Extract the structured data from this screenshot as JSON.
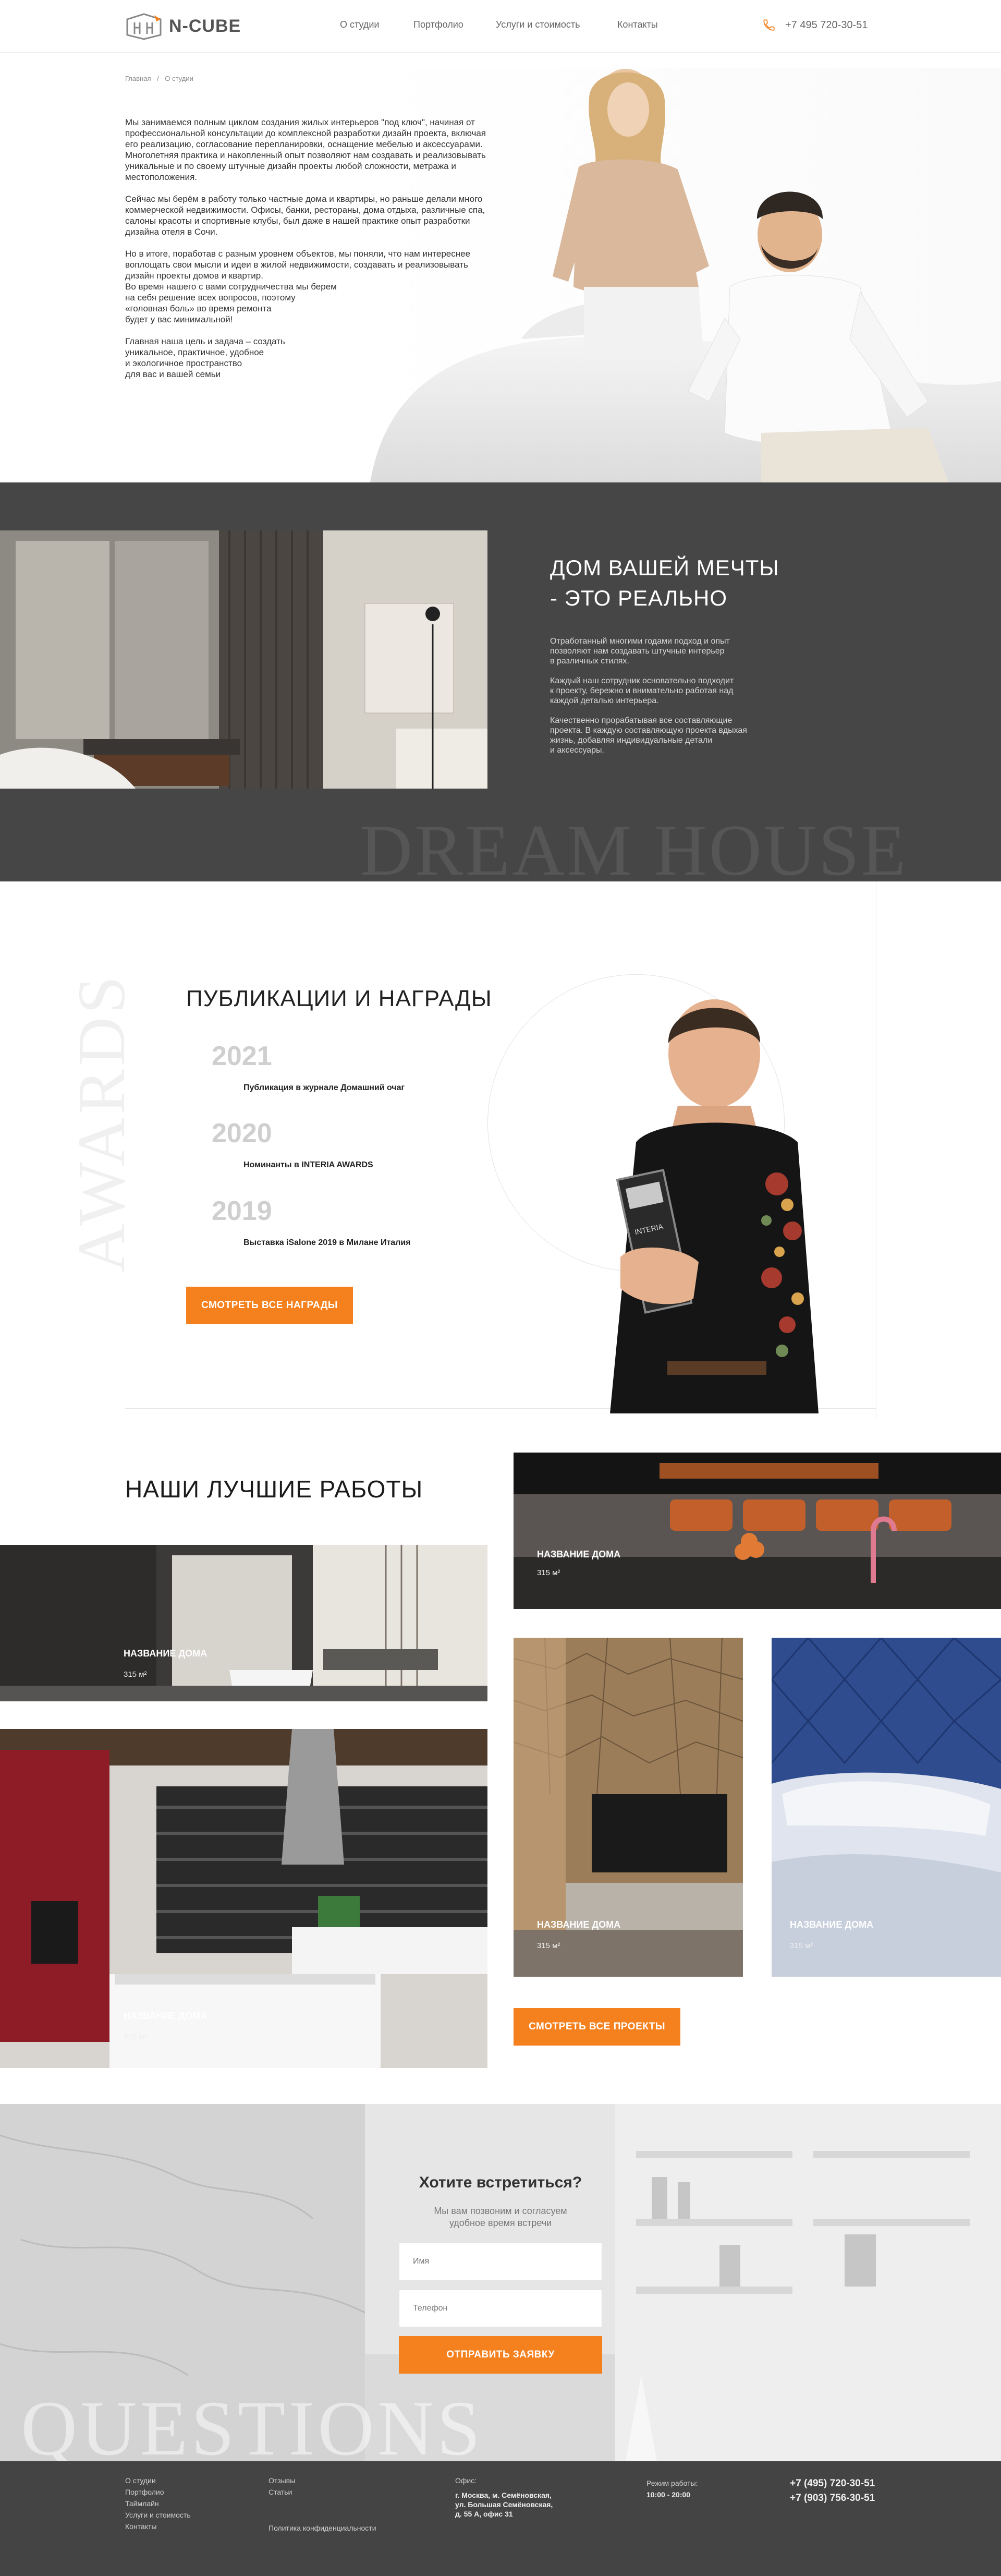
{
  "header": {
    "logo_text": "N-CUBE",
    "nav": [
      "О студии",
      "Портфолио",
      "Услуги и стоимость",
      "Контакты"
    ],
    "phone": "+7 495 720-30-51"
  },
  "about": {
    "breadcrumb_home": "Главная",
    "breadcrumb_sep": "/",
    "breadcrumb_current": "О студии",
    "paragraphs": [
      "Мы занимаемся полным циклом создания жилых интерьеров \"под ключ\", начиная от профессиональной консультации до комплексной разработки дизайн проекта, включая его реализацию, согласование перепланировки, оснащение мебелью и аксессуарами.\nМноголетняя практика и накопленный опыт позволяют нам создавать и реализовывать уникальные и по своему штучные дизайн проекты любой сложности, метража и местоположения.",
      "Сейчас мы берём в работу только частные дома и квартиры, но раньше делали много коммерческой недвижимости. Офисы, банки, рестораны, дома отдыха, различные спа, салоны красоты и спортивные клубы, был даже в нашей практике опыт разработки дизайна отеля в Сочи.",
      "Но в итоге, поработав с разным уровнем объектов, мы поняли, что нам интереснее воплощать свои мысли и идеи в жилой недвижимости, создавать и реализовывать дизайн проекты домов и квартир.\nВо время нашего с вами сотрудничества мы берем\nна себя решение всех вопросов, поэтому\n«головная боль» во время ремонта\nбудет у вас минимальной!",
      "Главная наша цель и задача – создать\nуникальное, практичное, удобное\nи экологичное пространство\nдля вас и вашей семьи"
    ]
  },
  "dream": {
    "title_line1": "ДОМ ВАШЕЙ МЕЧТЫ",
    "title_line2": "- ЭТО РЕАЛЬНО",
    "paragraphs": [
      "Отработанный многими годами подход и опыт\nпозволяют нам создавать штучные интерьер\nв различных стилях.",
      "Каждый наш сотрудник основательно подходит\nк проекту, бережно и внимательно работая над\nкаждой деталью интерьера.",
      "Качественно прорабатывая все составляющие\nпроекта. В каждую составляющую проекта вдыхая\nжизнь, добавляя индивидуальные детали\nи аксессуары."
    ],
    "watermark": "DREAM HOUSE"
  },
  "awards": {
    "watermark": "AWARDS",
    "title": "ПУБЛИКАЦИИ И НАГРАДЫ",
    "items": [
      {
        "year": "2021",
        "text": "Публикация в журнале Домашний очаг"
      },
      {
        "year": "2020",
        "text": "Номинанты в INTERIA AWARDS"
      },
      {
        "year": "2019",
        "text": "Выставка iSalone 2019 в Милане Италия"
      }
    ],
    "button": "СМОТРЕТЬ ВСЕ НАГРАДЫ"
  },
  "works": {
    "title": "НАШИ ЛУЧШИЕ РАБОТЫ",
    "cards": [
      {
        "name": "НАЗВАНИЕ ДОМА",
        "area": "315 м²"
      },
      {
        "name": "НАЗВАНИЕ ДОМА",
        "area": "315 м²"
      },
      {
        "name": "НАЗВАНИЕ ДОМА",
        "area": "315 м²"
      },
      {
        "name": "НАЗВАНИЕ ДОМА",
        "area": "315 м²"
      },
      {
        "name": "НАЗВАНИЕ ДОМА",
        "area": "315 м²"
      }
    ],
    "button": "СМОТРЕТЬ ВСЕ ПРОЕКТЫ"
  },
  "contact": {
    "title": "Хотите встретиться?",
    "subtitle": "Мы вам позвоним и согласуем\nудобное время встречи",
    "name_placeholder": "Имя",
    "phone_placeholder": "Телефон",
    "button": "ОТПРАВИТЬ ЗАЯВКУ",
    "watermark": "QUESTIONS"
  },
  "footer": {
    "col1": [
      "О студии",
      "Портфолио",
      "Таймлайн",
      "Услуги и стоимость",
      "Контакты"
    ],
    "col2": [
      "Отзывы",
      "Статьи"
    ],
    "privacy": "Политика конфиденциальности",
    "office_label": "Офис:",
    "office_address": "г. Москва, м. Семёновская,\nул. Большая Семёновская,\nд. 55 А, офис 31",
    "hours_label": "Режим работы:",
    "hours": "10:00 - 20:00",
    "phone1": "+7 (495) 720-30-51",
    "phone2": "+7 (903) 756-30-51"
  },
  "colors": {
    "accent": "#f5801e",
    "dark_band": "#474646",
    "footer_bg": "#444444"
  }
}
